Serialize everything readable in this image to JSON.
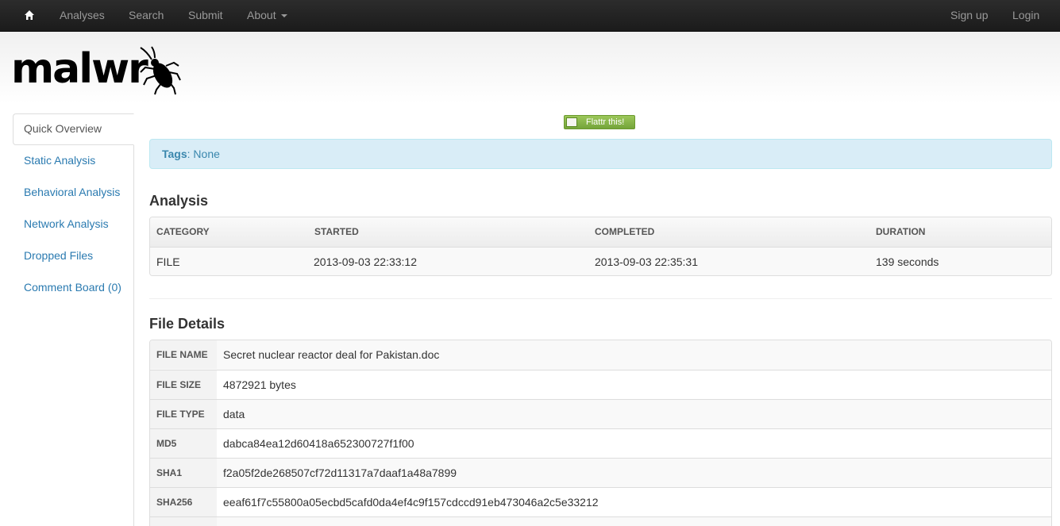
{
  "navbar": {
    "home_icon": "home-icon",
    "items": [
      "Analyses",
      "Search",
      "Submit",
      "About"
    ],
    "right_items": [
      "Sign up",
      "Login"
    ]
  },
  "logo": {
    "text": "malwr",
    "icon": "bug-icon"
  },
  "sidebar": {
    "items": [
      {
        "label": "Quick Overview"
      },
      {
        "label": "Static Analysis"
      },
      {
        "label": "Behavioral Analysis"
      },
      {
        "label": "Network Analysis"
      },
      {
        "label": "Dropped Files"
      },
      {
        "label": "Comment Board (0)"
      }
    ]
  },
  "flattr": {
    "label": "Flattr this!",
    "color": "#7fb042"
  },
  "tags": {
    "label": "Tags",
    "value": ": None"
  },
  "analysis": {
    "title": "Analysis",
    "headers": [
      "CATEGORY",
      "STARTED",
      "COMPLETED",
      "DURATION"
    ],
    "row": [
      "FILE",
      "2013-09-03 22:33:12",
      "2013-09-03 22:35:31",
      "139 seconds"
    ]
  },
  "file_details": {
    "title": "File Details",
    "rows": [
      {
        "label": "FILE NAME",
        "value": "Secret nuclear reactor deal for Pakistan.doc"
      },
      {
        "label": "FILE SIZE",
        "value": "4872921 bytes"
      },
      {
        "label": "FILE TYPE",
        "value": "data"
      },
      {
        "label": "MD5",
        "value": "dabca84ea12d60418a652300727f1f00"
      },
      {
        "label": "SHA1",
        "value": "f2a05f2de268507cf72d11317a7daaf1a48a7899"
      },
      {
        "label": "SHA256",
        "value": "eeaf61f7c55800a05ecbd5cafd0da4ef4c9f157cdccd91eb473046a2c5e33212"
      }
    ]
  },
  "colors": {
    "link": "#2a7ab0",
    "navbar": "#1b1b1b",
    "info_bg": "#d9edf7"
  }
}
